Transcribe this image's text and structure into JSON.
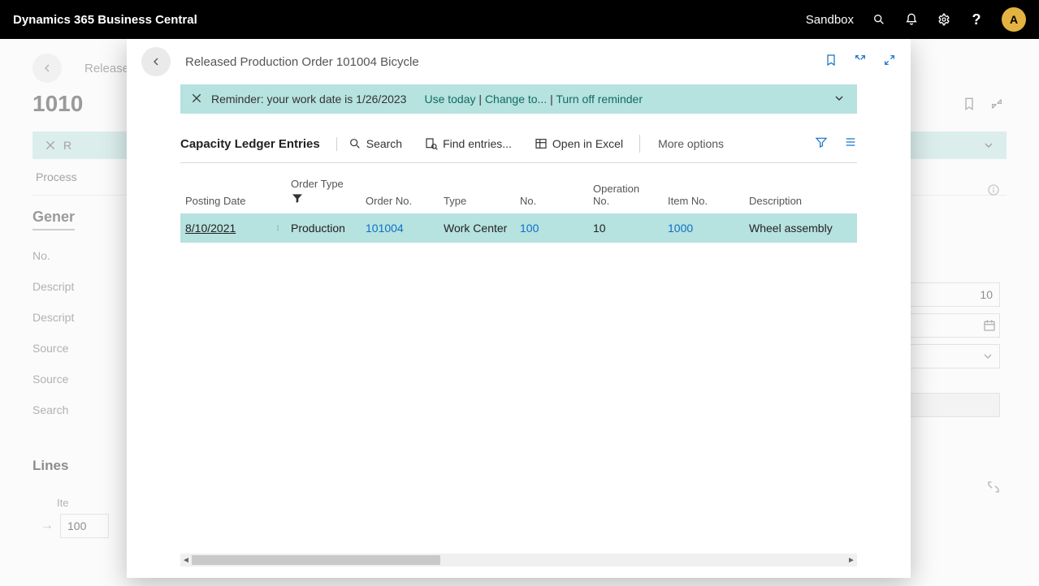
{
  "header": {
    "app_name": "Dynamics 365 Business Central",
    "env_badge": "Sandbox",
    "avatar_initial": "A",
    "help_label": "?"
  },
  "background": {
    "breadcrumb": "Released",
    "page_number_partial": "1010",
    "reminder_prefix": "R",
    "action_process": "Process",
    "section_general": "Gener",
    "fields": {
      "no": "No.",
      "description": "Descript",
      "description2": "Descript",
      "source_type": "Source ",
      "source_no": "Source ",
      "search": "Search "
    },
    "lines_label": "Lines",
    "lines_col": "Ite",
    "lines_row_prefix": "100",
    "right_input_value": "10"
  },
  "panel": {
    "title": "Released Production Order 101004 Bicycle",
    "reminder": {
      "text": "Reminder: your work date is 1/26/2023",
      "use_today": "Use today",
      "change_to": "Change to...",
      "turn_off": "Turn off reminder"
    },
    "toolbar": {
      "title": "Capacity Ledger Entries",
      "search": "Search",
      "find": "Find entries...",
      "excel": "Open in Excel",
      "more": "More options"
    },
    "columns": {
      "posting_date": "Posting Date",
      "order_type": "Order Type",
      "order_no": "Order No.",
      "type": "Type",
      "no": "No.",
      "operation_no": "Operation No.",
      "item_no": "Item No.",
      "description": "Description"
    },
    "rows": [
      {
        "posting_date": "8/10/2021",
        "order_type": "Production",
        "order_no": "101004",
        "type": "Work Center",
        "no": "100",
        "operation_no": "10",
        "item_no": "1000",
        "description": "Wheel assembly"
      }
    ]
  }
}
